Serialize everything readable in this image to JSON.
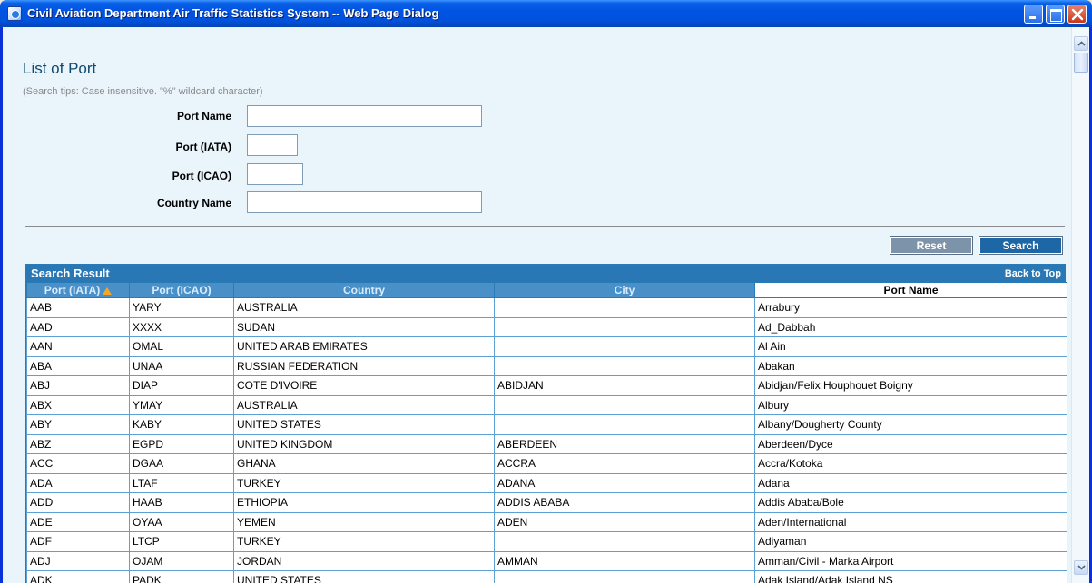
{
  "window": {
    "title": "Civil Aviation Department Air Traffic Statistics System -- Web Page Dialog"
  },
  "page": {
    "heading": "List of Port",
    "search_tips": "(Search tips: Case insensitive. \"%\" wildcard character)"
  },
  "form": {
    "port_name_label": "Port Name",
    "port_name_value": "",
    "port_iata_label": "Port (IATA)",
    "port_iata_value": "",
    "port_icao_label": "Port (ICAO)",
    "port_icao_value": "",
    "country_name_label": "Country Name",
    "country_name_value": ""
  },
  "buttons": {
    "reset": "Reset",
    "search": "Search"
  },
  "results": {
    "title": "Search Result",
    "back_to_top": "Back to Top",
    "sort_column": "Port (IATA)",
    "sort_direction": "ascending",
    "columns": [
      "Port (IATA)",
      "Port (ICAO)",
      "Country",
      "City",
      "Port Name"
    ],
    "rows": [
      [
        "AAB",
        "YARY",
        "AUSTRALIA",
        "",
        "Arrabury"
      ],
      [
        "AAD",
        "XXXX",
        "SUDAN",
        "",
        "Ad_Dabbah"
      ],
      [
        "AAN",
        "OMAL",
        "UNITED ARAB EMIRATES",
        "",
        "Al Ain"
      ],
      [
        "ABA",
        "UNAA",
        "RUSSIAN FEDERATION",
        "",
        "Abakan"
      ],
      [
        "ABJ",
        "DIAP",
        "COTE D'IVOIRE",
        "ABIDJAN",
        "Abidjan/Felix Houphouet Boigny"
      ],
      [
        "ABX",
        "YMAY",
        "AUSTRALIA",
        "",
        "Albury"
      ],
      [
        "ABY",
        "KABY",
        "UNITED STATES",
        "",
        "Albany/Dougherty County"
      ],
      [
        "ABZ",
        "EGPD",
        "UNITED KINGDOM",
        "ABERDEEN",
        "Aberdeen/Dyce"
      ],
      [
        "ACC",
        "DGAA",
        "GHANA",
        "ACCRA",
        "Accra/Kotoka"
      ],
      [
        "ADA",
        "LTAF",
        "TURKEY",
        "ADANA",
        "Adana"
      ],
      [
        "ADD",
        "HAAB",
        "ETHIOPIA",
        "ADDIS ABABA",
        "Addis Ababa/Bole"
      ],
      [
        "ADE",
        "OYAA",
        "YEMEN",
        "ADEN",
        "Aden/International"
      ],
      [
        "ADF",
        "LTCP",
        "TURKEY",
        "",
        "Adiyaman"
      ],
      [
        "ADJ",
        "OJAM",
        "JORDAN",
        "AMMAN",
        "Amman/Civil - Marka Airport"
      ],
      [
        "ADK",
        "PADK",
        "UNITED STATES",
        "",
        "Adak Island/Adak Island NS"
      ]
    ]
  },
  "icons": {
    "window_icon": "ie-dialog-icon",
    "minimize": "minimize-icon",
    "maximize": "maximize-icon",
    "close": "close-icon",
    "sort": "sort-ascending-icon"
  },
  "colors": {
    "title_bar": "#0054e3",
    "panel_header": "#2978b5",
    "heading": "#104a6e",
    "search_button": "#1e67a6",
    "reset_button": "#7d93a9",
    "sort_arrow": "#f5a623"
  }
}
